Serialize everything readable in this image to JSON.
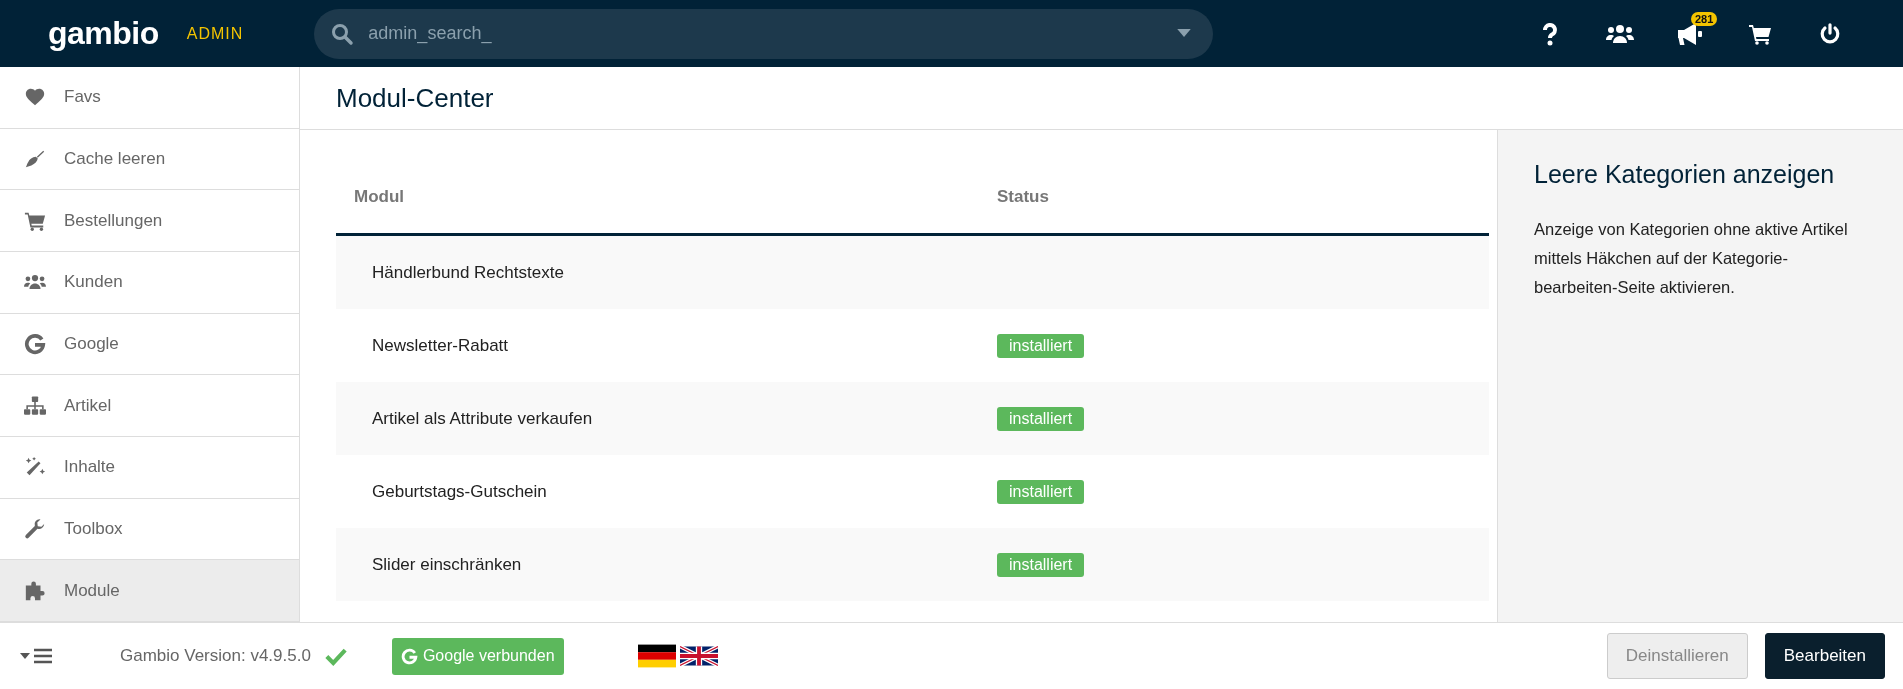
{
  "topbar": {
    "logo": "gambio",
    "tag": "ADMIN",
    "search": {
      "placeholder": "admin_search_"
    },
    "notification_count": "281"
  },
  "sidebar": {
    "items": [
      {
        "label": "Favs",
        "selected": false
      },
      {
        "label": "Cache leeren",
        "selected": false
      },
      {
        "label": "Bestellungen",
        "selected": false
      },
      {
        "label": "Kunden",
        "selected": false
      },
      {
        "label": "Google",
        "selected": false
      },
      {
        "label": "Artikel",
        "selected": false
      },
      {
        "label": "Inhalte",
        "selected": false
      },
      {
        "label": "Toolbox",
        "selected": false
      },
      {
        "label": "Module",
        "selected": true
      }
    ]
  },
  "page_title": "Modul-Center",
  "table": {
    "columns": [
      "Modul",
      "Status"
    ],
    "rows": [
      {
        "module": "Händlerbund Rechtstexte"
      },
      {
        "module": "Newsletter-Rabatt",
        "status": "installiert"
      },
      {
        "module": "Artikel als Attribute verkaufen",
        "status": "installiert"
      },
      {
        "module": "Geburtstags-Gutschein",
        "status": "installiert"
      },
      {
        "module": "Slider einschränken",
        "status": "installiert"
      }
    ]
  },
  "info_panel": {
    "title": "Leere Kategorien anzeigen",
    "text": "Anzeige von Kategorien ohne aktive Artikel mittels Häkchen auf der Kategorie-bearbeiten-Seite aktivieren."
  },
  "footer": {
    "version": "Gambio Version: v4.9.5.0",
    "version_ok": true,
    "google_button": "Google verbunden",
    "languages": [
      {
        "kind": "de"
      },
      {
        "kind": "en"
      }
    ],
    "buttons": [
      {
        "label": "Deinstallieren",
        "kind": "secondary"
      },
      {
        "label": "Bearbeiten",
        "kind": "primary"
      }
    ]
  }
}
